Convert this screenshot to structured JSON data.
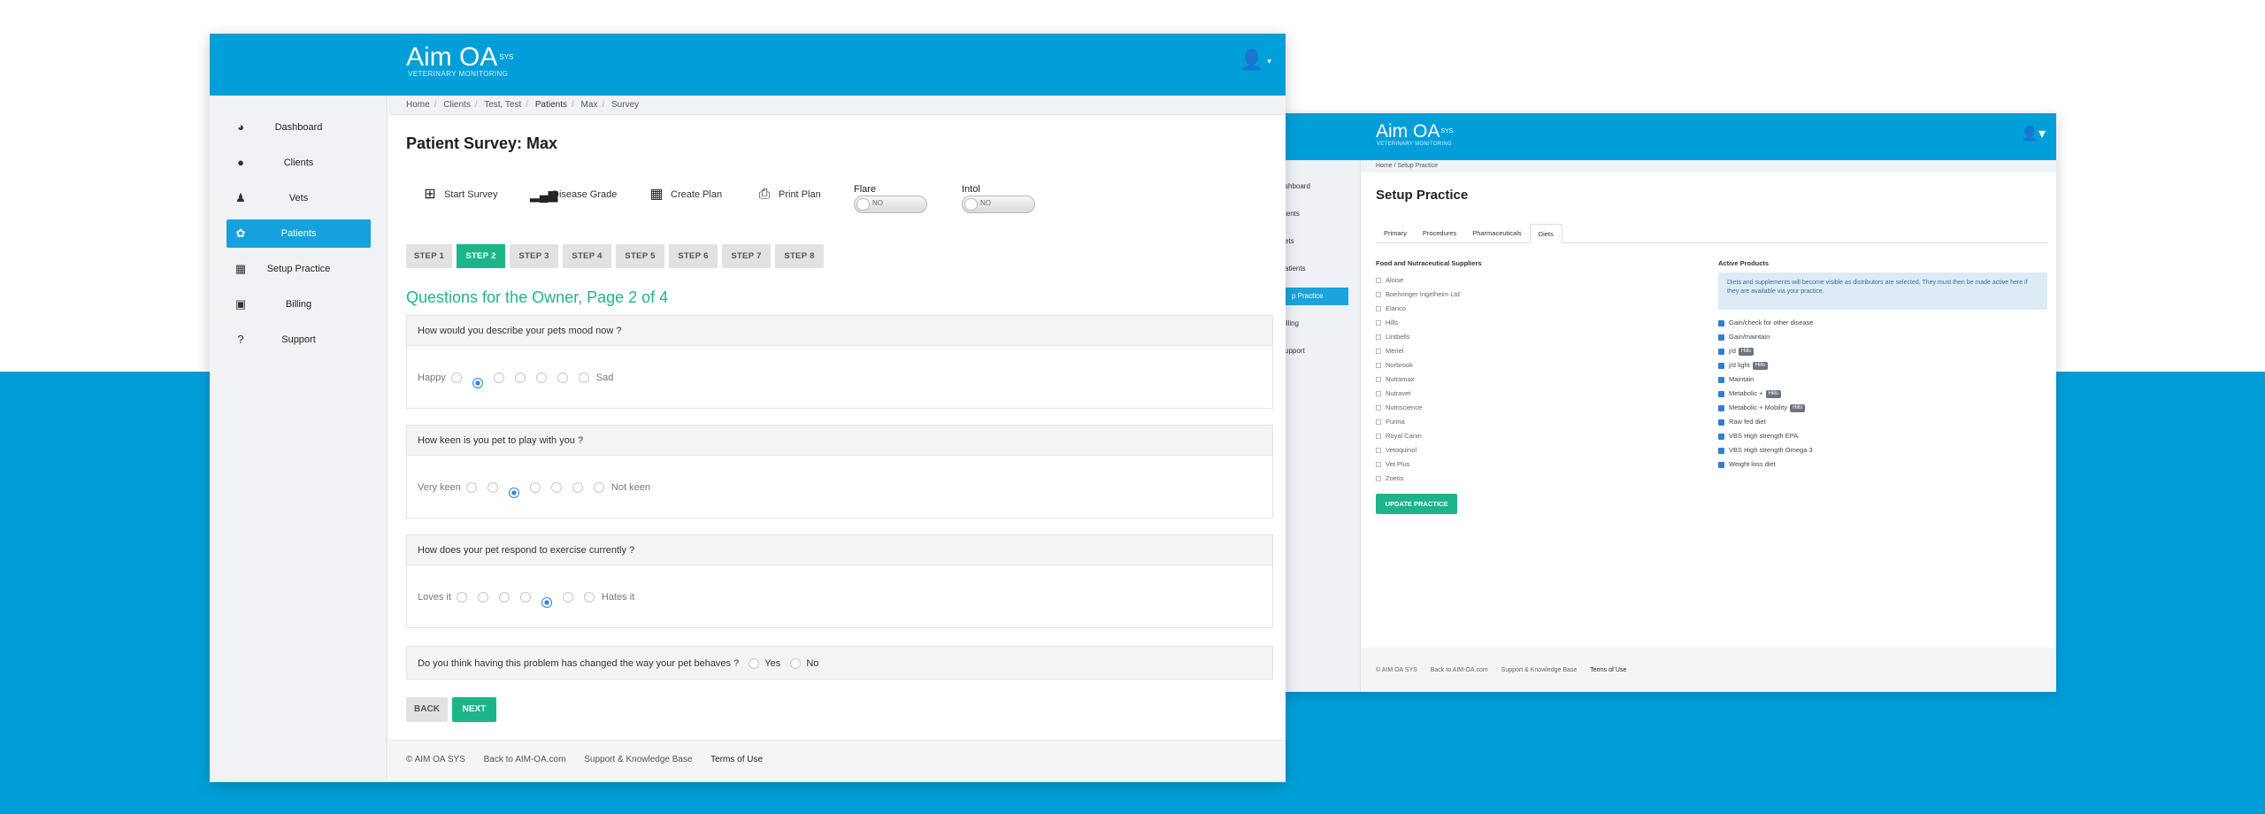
{
  "brand": {
    "name": "Aim OA",
    "sup": "SYS",
    "tagline": "VETERINARY MONITORING"
  },
  "front": {
    "nav": [
      {
        "label": "Dashboard",
        "icon": "dashboard-icon"
      },
      {
        "label": "Clients",
        "icon": "user-icon"
      },
      {
        "label": "Vets",
        "icon": "doctor-icon"
      },
      {
        "label": "Patients",
        "icon": "paw-icon",
        "active": true
      },
      {
        "label": "Setup Practice",
        "icon": "building-icon"
      },
      {
        "label": "Billing",
        "icon": "money-icon"
      },
      {
        "label": "Support",
        "icon": "question-icon"
      }
    ],
    "breadcrumb": [
      "Home",
      "Clients",
      "Test, Test",
      "Patients",
      "Max",
      "Survey"
    ],
    "title": "Patient Survey: Max",
    "actions": [
      "Start Survey",
      "Disease Grade",
      "Create Plan",
      "Print Plan"
    ],
    "toggles": [
      {
        "label": "Flare",
        "value": "NO"
      },
      {
        "label": "Intol",
        "value": "NO"
      }
    ],
    "steps": [
      "STEP 1",
      "STEP 2",
      "STEP 3",
      "STEP 4",
      "STEP 5",
      "STEP 6",
      "STEP 7",
      "STEP 8"
    ],
    "active_step": 2,
    "section_title": "Questions for the Owner, Page 2 of 4",
    "questions": [
      {
        "text": "How would you describe your pets mood now ?",
        "low": "Happy",
        "high": "Sad",
        "selected": 2,
        "count": 7
      },
      {
        "text": "How keen is you pet to play with you ?",
        "low": "Very keen",
        "high": "Not keen",
        "selected": 3,
        "count": 7
      },
      {
        "text": "How does your pet respond to exercise currently ?",
        "low": "Loves it",
        "high": "Hates it",
        "selected": 5,
        "count": 7
      }
    ],
    "yesno_question": {
      "text": "Do you think having this problem has changed the way your pet behaves ?",
      "yes": "Yes",
      "no": "No"
    },
    "buttons": {
      "back": "BACK",
      "next": "NEXT"
    },
    "footer": {
      "copyright": "© AIM OA SYS",
      "link1": "Back to AIM-OA.com",
      "link2": "Support & Knowledge Base",
      "link3": "Terms of Use"
    }
  },
  "back": {
    "nav": [
      "Dashboard",
      "Clients",
      "Vets",
      "Patients",
      "Setup Practice",
      "Billing",
      "Support"
    ],
    "nav_visible": [
      "shboard",
      "ients",
      "ets",
      "atients",
      "p Practice",
      "illing",
      "upport"
    ],
    "breadcrumb": "Home / Setup Practice",
    "title": "Setup Practice",
    "tabs": [
      "Primary",
      "Procedures",
      "Pharmaceuticals",
      "Diets"
    ],
    "active_tab": "Diets",
    "suppliers_header": "Food and Nutraceutical Suppliers",
    "suppliers": [
      "Aloise",
      "Boehringer Ingelheim Ltd",
      "Elanco",
      "Hills",
      "Lintbells",
      "Meriel",
      "Norbrook",
      "Nutramax",
      "Nutravet",
      "Nutriscience",
      "Purina",
      "Royal Canin",
      "Vetoquinol",
      "Vet Plus",
      "Zoetis"
    ],
    "products_header": "Active Products",
    "notice": "Diets and supplements will become visible as distributors are selected. They must then be made active here if they are available via your practice.",
    "products": [
      {
        "name": "Gain/check for other disease"
      },
      {
        "name": "Gain/maintain"
      },
      {
        "name": "j/d",
        "badge": "Hills"
      },
      {
        "name": "j/d light",
        "badge": "Hills"
      },
      {
        "name": "Maintain"
      },
      {
        "name": "Metabolic +",
        "badge": "Hills"
      },
      {
        "name": "Metabolic + Mobility",
        "badge": "Hills"
      },
      {
        "name": "Raw fed diet"
      },
      {
        "name": "VBS High strength EPA"
      },
      {
        "name": "VBS High strength Omega 3"
      },
      {
        "name": "Weight loss diet"
      }
    ],
    "update_button": "UPDATE PRACTICE",
    "footer": {
      "copyright": "© AIM OA SYS",
      "link1": "Back to AIM-OA.com",
      "link2": "Support & Knowledge Base",
      "link3": "Terms of Use"
    }
  }
}
